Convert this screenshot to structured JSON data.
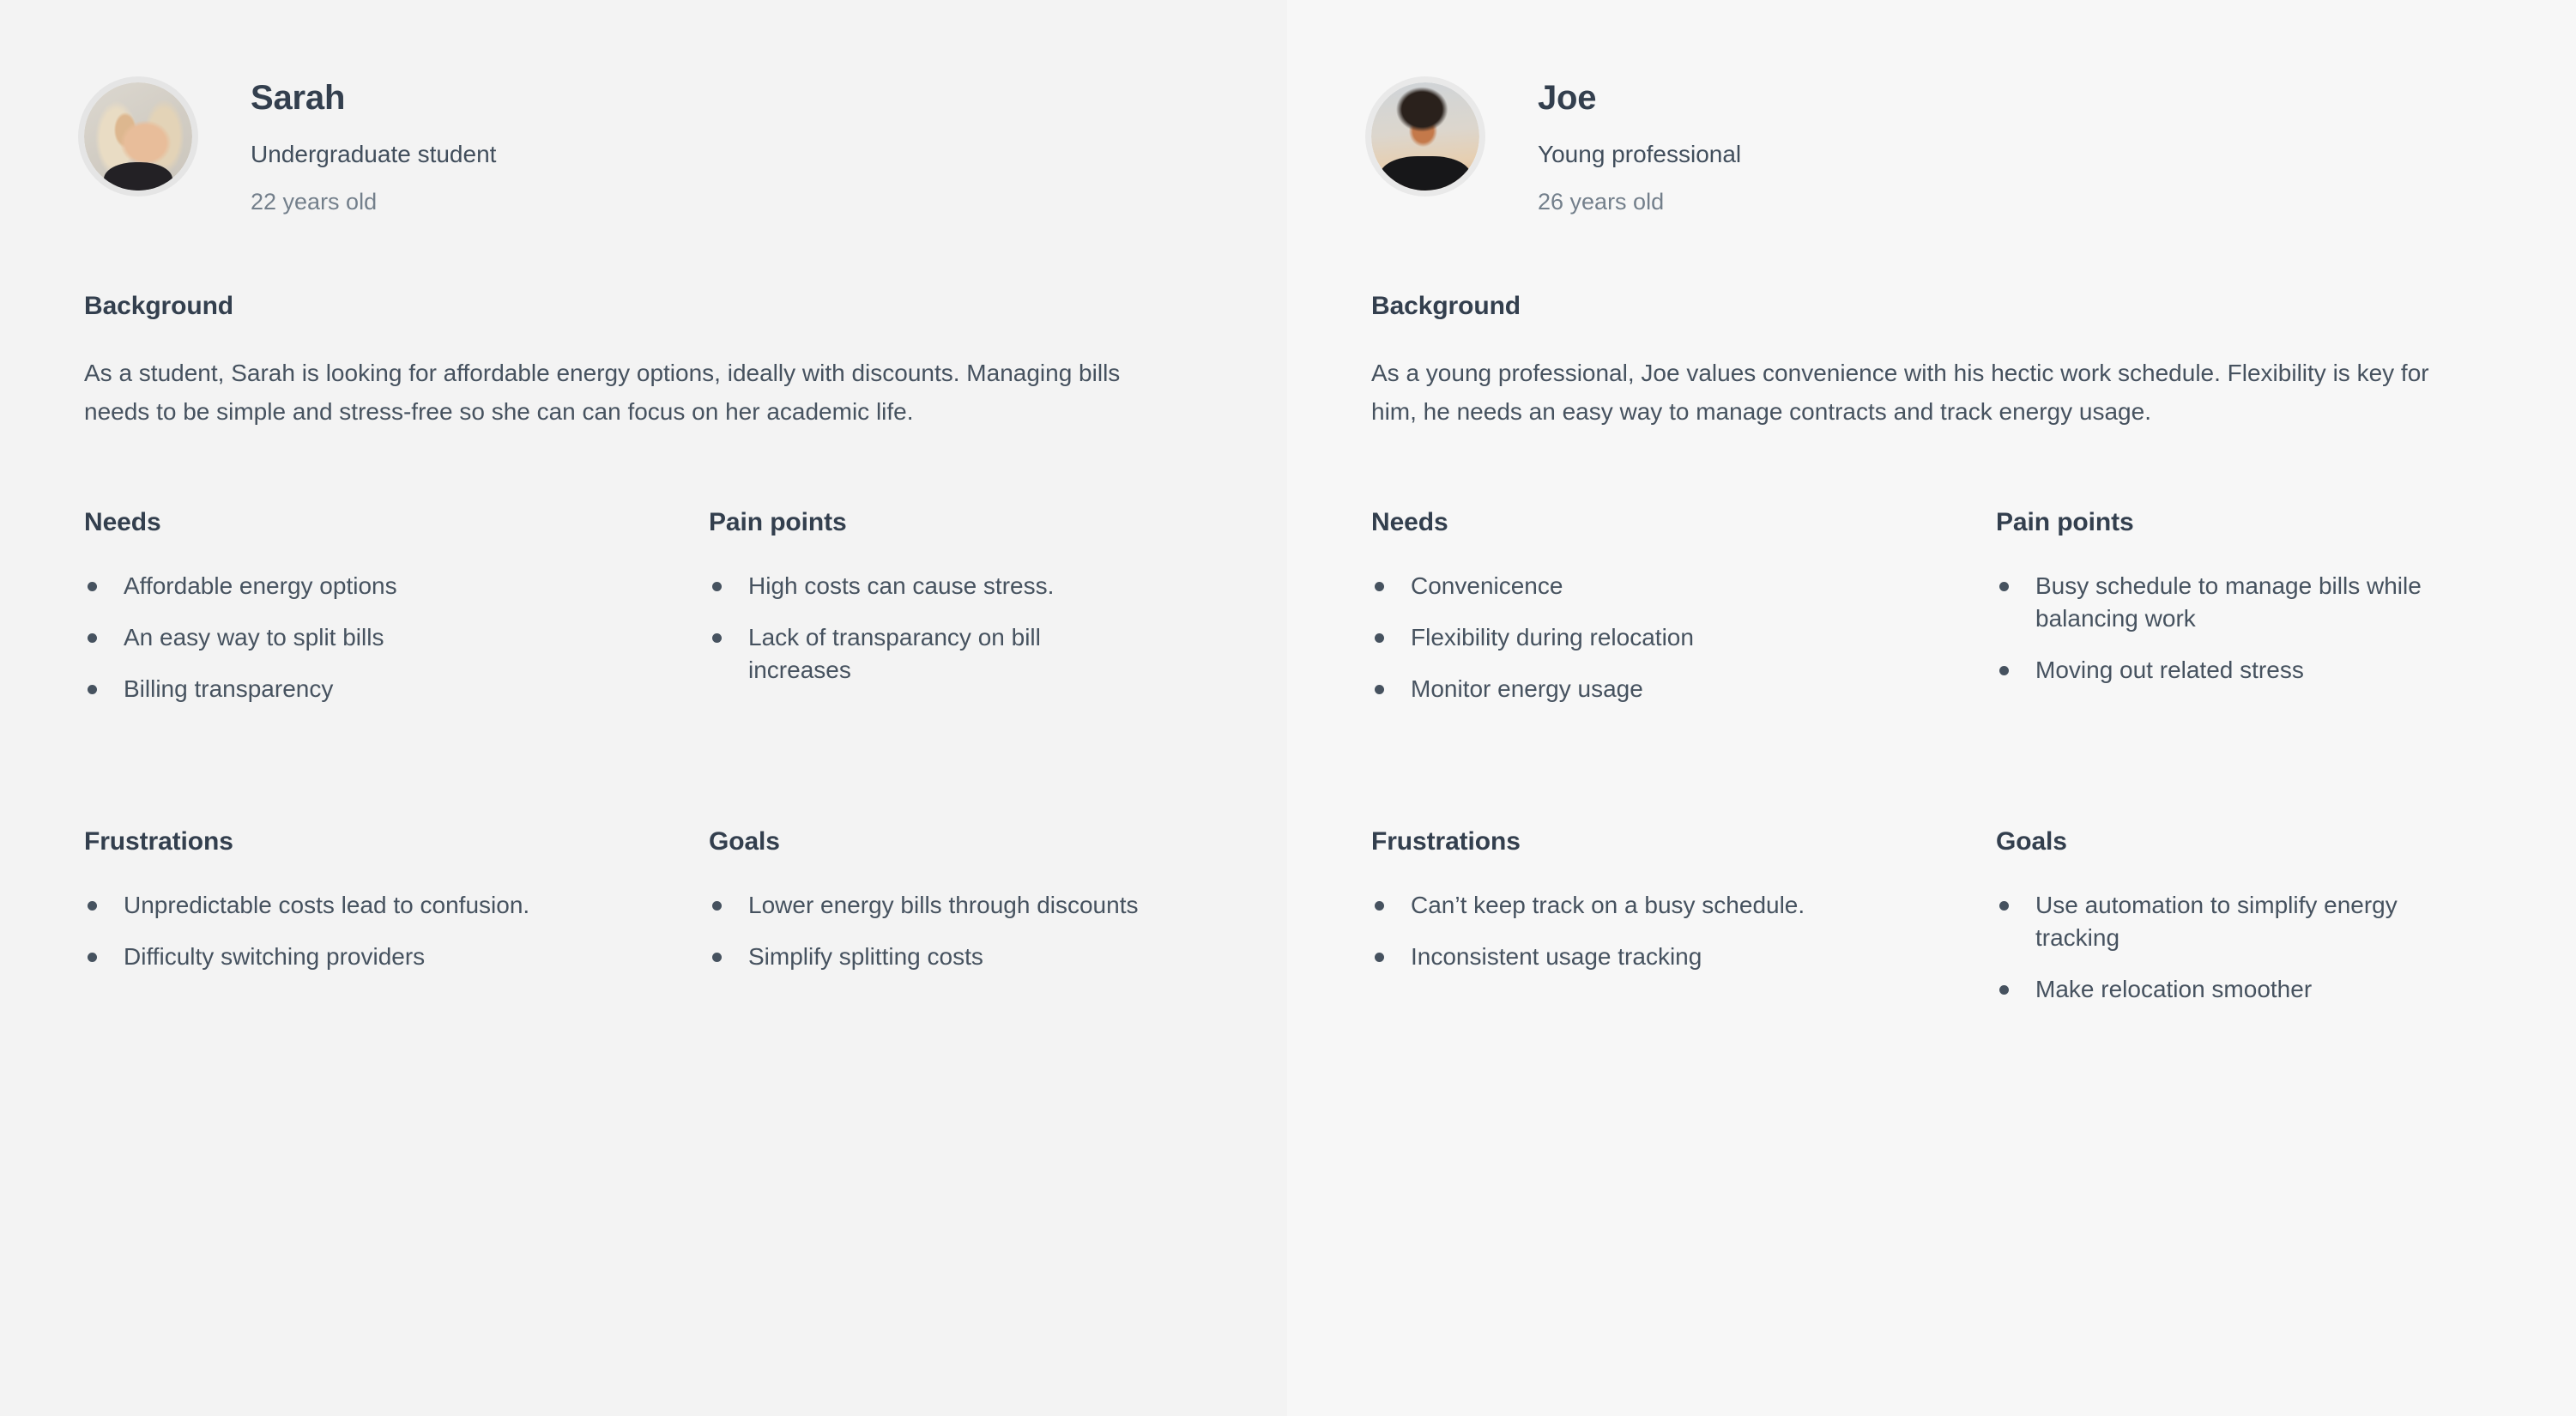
{
  "colors": {
    "heading": "#333f4e",
    "body": "#46525f",
    "muted": "#737f8b",
    "panel_left_bg": "#f3f3f3",
    "panel_right_bg": "#f7f7f7"
  },
  "section_labels": {
    "background": "Background",
    "needs": "Needs",
    "pain_points": "Pain points",
    "frustrations": "Frustrations",
    "goals": "Goals"
  },
  "personas": [
    {
      "name": "Sarah",
      "role": "Undergraduate student",
      "age": "22 years old",
      "avatar": "sarah-portrait",
      "background": "As a student, Sarah is looking for affordable energy options, ideally with discounts. Managing bills needs to be simple and stress-free so she can can focus on her academic life.",
      "needs": [
        "Affordable energy options",
        "An easy way to split bills",
        "Billing transparency"
      ],
      "pain_points": [
        "High costs can cause stress.",
        "Lack of transparancy on bill increases"
      ],
      "frustrations": [
        "Unpredictable costs lead to confusion.",
        "Difficulty switching providers"
      ],
      "goals": [
        "Lower energy bills through discounts",
        "Simplify splitting costs"
      ]
    },
    {
      "name": "Joe",
      "role": "Young professional",
      "age": "26 years old",
      "avatar": "joe-portrait",
      "background": "As a young professional, Joe values convenience with his hectic work schedule. Flexibility is key for him, he needs an easy way to manage contracts and track energy usage.",
      "needs": [
        "Convenicence",
        "Flexibility during relocation",
        "Monitor energy usage"
      ],
      "pain_points": [
        "Busy schedule to manage bills while balancing work",
        "Moving out related stress"
      ],
      "frustrations": [
        "Can’t keep track on a busy schedule.",
        "Inconsistent usage tracking"
      ],
      "goals": [
        "Use automation to simplify energy tracking",
        "Make relocation smoother"
      ]
    }
  ]
}
